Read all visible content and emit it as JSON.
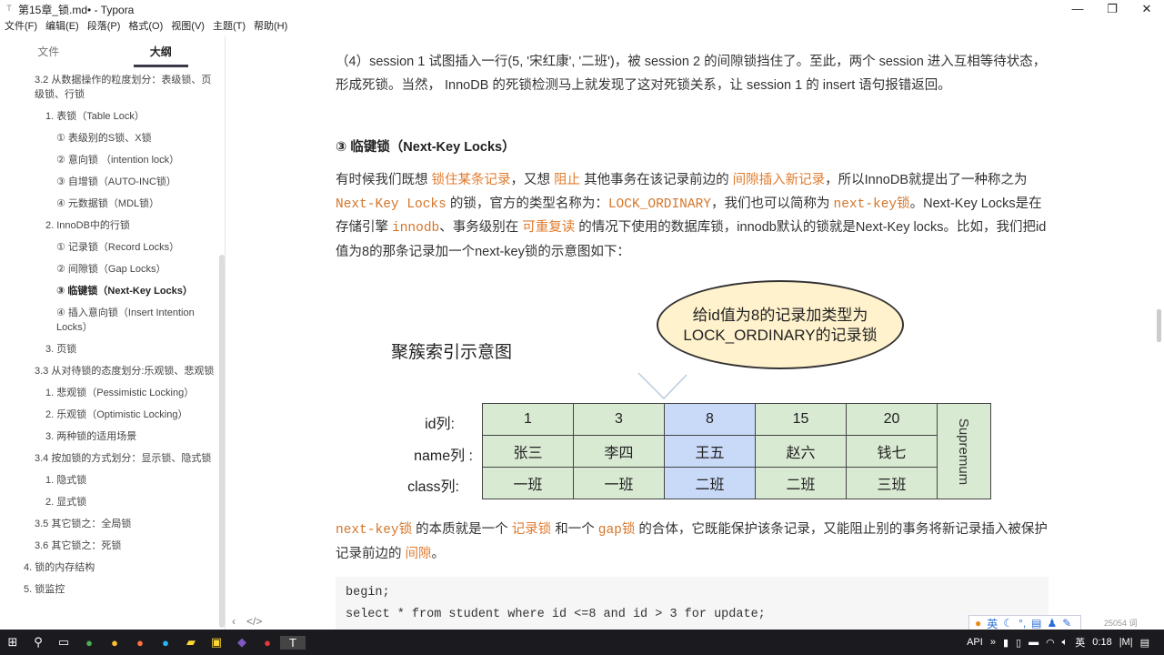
{
  "window": {
    "title": "第15章_锁.md• - Typora",
    "min": "—",
    "max": "❐",
    "close": "✕"
  },
  "menu": [
    "文件(F)",
    "编辑(E)",
    "段落(P)",
    "格式(O)",
    "视图(V)",
    "主题(T)",
    "帮助(H)"
  ],
  "sidebar": {
    "tabs": [
      "文件",
      "大纲"
    ],
    "items": [
      {
        "label": "3.2 从数据操作的粒度划分：表级锁、页级锁、行锁",
        "indent": 38
      },
      {
        "label": "1. 表锁（Table Lock）",
        "indent": 50
      },
      {
        "label": "① 表级别的S锁、X锁",
        "indent": 62
      },
      {
        "label": "② 意向锁 （intention lock）",
        "indent": 62
      },
      {
        "label": "③ 自增锁（AUTO-INC锁）",
        "indent": 62
      },
      {
        "label": "④ 元数据锁（MDL锁）",
        "indent": 62
      },
      {
        "label": "2. InnoDB中的行锁",
        "indent": 50
      },
      {
        "label": "① 记录锁（Record Locks）",
        "indent": 62
      },
      {
        "label": "② 间隙锁（Gap Locks）",
        "indent": 62
      },
      {
        "label": "③ 临键锁（Next-Key Locks）",
        "indent": 62,
        "active": true
      },
      {
        "label": "④ 插入意向锁（Insert Intention Locks）",
        "indent": 62
      },
      {
        "label": "3. 页锁",
        "indent": 50
      },
      {
        "label": "3.3 从对待锁的态度划分:乐观锁、悲观锁",
        "indent": 38
      },
      {
        "label": "1. 悲观锁（Pessimistic Locking）",
        "indent": 50
      },
      {
        "label": "2. 乐观锁（Optimistic Locking）",
        "indent": 50
      },
      {
        "label": "3. 两种锁的适用场景",
        "indent": 50
      },
      {
        "label": "3.4 按加锁的方式划分：显示锁、隐式锁",
        "indent": 38
      },
      {
        "label": "1. 隐式锁",
        "indent": 50
      },
      {
        "label": "2. 显式锁",
        "indent": 50
      },
      {
        "label": "3.5 其它锁之：全局锁",
        "indent": 38
      },
      {
        "label": "3.6 其它锁之：死锁",
        "indent": 38
      },
      {
        "label": "4. 锁的内存结构",
        "indent": 26
      },
      {
        "label": "5. 锁监控",
        "indent": 26
      }
    ]
  },
  "content": {
    "para4": "（4）session 1 试图插入一行(5, '宋红康', '二班')，被 session 2 的间隙锁挡住了。至此，两个 session 进入互相等待状态，形成死锁。当然， InnoDB 的死锁检测马上就发现了这对死锁关系，让 session 1 的 insert 语句报错返回。",
    "heading": "③ 临键锁（Next-Key Locks）",
    "p1": {
      "a": "有时候我们既想 ",
      "b": "锁住某条记录",
      "c": "，又想 ",
      "d": "阻止",
      "e": " 其他事务在该记录前边的 ",
      "f": "间隙插入新记录",
      "g": "，所以InnoDB就提出了一种称之为 ",
      "h": "Next-Key Locks",
      "i": " 的锁，官方的类型名称为：",
      "j": "LOCK_ORDINARY",
      "k": "，我们也可以简称为 ",
      "l": "next-key锁",
      "m": "。Next-Key Locks是在存储引擎 ",
      "n": "innodb",
      "o": "、事务级别在 ",
      "p": "可重复读",
      "q": " 的情况下使用的数据库锁，innodb默认的锁就是Next-Key locks。比如，我们把id值为8的那条记录加一个next-key锁的示意图如下："
    },
    "diagram": {
      "title": "聚簇索引示意图",
      "bubble1": "给id值为8的记录加类型为",
      "bubble2": "LOCK_ORDINARY的记录锁",
      "labels": [
        "id列:",
        "name列 :",
        "class列:"
      ],
      "ids": [
        "1",
        "3",
        "8",
        "15",
        "20"
      ],
      "names": [
        "张三",
        "李四",
        "王五",
        "赵六",
        "钱七"
      ],
      "classes": [
        "一班",
        "一班",
        "二班",
        "二班",
        "三班"
      ],
      "supremum": "Supremum"
    },
    "p2": {
      "a": "next-key锁",
      "b": " 的本质就是一个 ",
      "c": "记录锁",
      "d": " 和一个 ",
      "e": "gap锁",
      "f": " 的合体，它既能保护该条记录，又能阻止别的事务将新记录插入被保护记录前边的 ",
      "g": "间隙",
      "h": "。"
    },
    "code": [
      "begin;",
      "select * from student where id <=8 and id > 3 for update;"
    ]
  },
  "status": {
    "wordcount": "25054 词",
    "ime": "英"
  },
  "taskbar": {
    "api": "API",
    "lang": "英",
    "time": "0:18"
  }
}
